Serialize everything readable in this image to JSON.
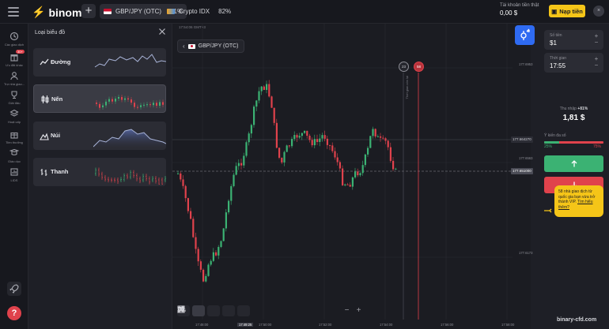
{
  "topbar": {
    "logo": "binomo",
    "add_label": "+",
    "tabs": [
      {
        "label": "GBP/JPY (OTC)",
        "pct": "81%",
        "active": true
      },
      {
        "label": "Crypto IDX",
        "pct": "82%",
        "active": false
      }
    ],
    "account_label": "Tài khoản tiền thật",
    "account_value": "0,00 $",
    "deposit_label": "Nạp tiền"
  },
  "sidebar": {
    "items": [
      {
        "label": "Các giao dịch",
        "icon": "clock-icon"
      },
      {
        "label": "Ưu đãi khác",
        "icon": "gift-icon",
        "badge": "30+"
      },
      {
        "label": "Trợ nhà giao...",
        "icon": "user-icon"
      },
      {
        "label": "Giải đấu",
        "icon": "trophy-icon"
      },
      {
        "label": "Hoạt cấp",
        "icon": "stack-icon"
      },
      {
        "label": "Tiền thưởng",
        "icon": "present-icon"
      },
      {
        "label": "Giáo dục",
        "icon": "book-icon"
      },
      {
        "label": "LIDS",
        "icon": "chart-bar-icon"
      }
    ]
  },
  "panel": {
    "title": "Loại biểu đồ",
    "types": [
      {
        "label": "Đường",
        "icon": "line-icon",
        "active": false
      },
      {
        "label": "Nến",
        "icon": "candles-icon",
        "active": true
      },
      {
        "label": "Núi",
        "icon": "mountain-icon",
        "active": false
      },
      {
        "label": "Thanh",
        "icon": "bars-icon",
        "active": false
      }
    ]
  },
  "chart": {
    "clock": "17:54:06 GMT+3",
    "pair": "GBP/JPY (OTC)",
    "expiry_a": "23",
    "expiry_b": "58",
    "vertical_label": "Thời gian còn lại",
    "price_labels": [
      "177.6953",
      "177.6563",
      "177.6173"
    ],
    "price_tag": "177.664270",
    "current_price": "177.651000",
    "time_labels": [
      "17:48:00",
      "17:49:25",
      "17:50:00",
      "17:52:00",
      "17:54:00",
      "17:56:00",
      "17:58:00"
    ],
    "highlighted_time_index": 1,
    "timeframe": "5s",
    "zoom_minus": "−",
    "zoom_plus": "+"
  },
  "trade": {
    "amount_label": "Số tiền",
    "amount_value": "$1",
    "time_label": "Thời gian",
    "time_value": "17:55",
    "income_label": "Thu nhập",
    "income_pct": "+81%",
    "income_value": "1,81 $",
    "sentiment_label": "Ý kiến đa số",
    "sentiment_up": "25%",
    "sentiment_down": "75%",
    "sentiment_up_fraction": 0.25,
    "promo_text": "58 nhà giao dịch từ quốc gia bạn vừa trở thành VIP.",
    "promo_link": "Tìm hiểu thêm?"
  },
  "watermark": "binary-cfd.com",
  "colors": {
    "up": "#3bb273",
    "down": "#e0424c",
    "brand": "#f5c518",
    "accent": "#2f6bf2"
  }
}
